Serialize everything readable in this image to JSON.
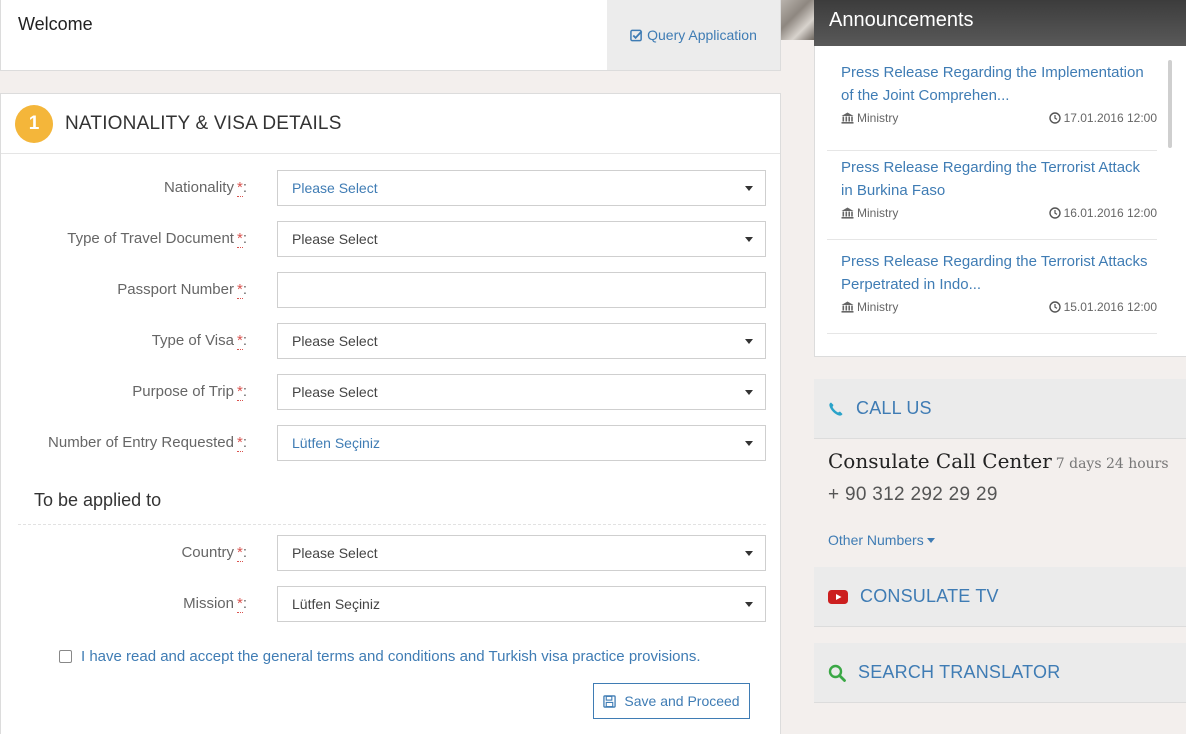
{
  "header": {
    "welcome": "Welcome",
    "query_application": "Query Application"
  },
  "form": {
    "step_number": "1",
    "section_title": "NATIONALITY & VISA DETAILS",
    "required_marker": "*",
    "colon": ":",
    "fields": [
      {
        "label": "Nationality",
        "value": "Please Select",
        "type": "select"
      },
      {
        "label": "Type of Travel Document",
        "value": "Please Select",
        "type": "select"
      },
      {
        "label": "Passport Number",
        "value": "",
        "type": "text"
      },
      {
        "label": "Type of Visa",
        "value": "Please Select",
        "type": "select"
      },
      {
        "label": "Purpose of Trip",
        "value": "Please Select",
        "type": "select"
      },
      {
        "label": "Number of Entry Requested",
        "value": "Lütfen Seçiniz",
        "type": "select"
      }
    ],
    "applied_to_heading": "To be applied to",
    "applied_fields": [
      {
        "label": "Country",
        "value": "Please Select",
        "type": "select"
      },
      {
        "label": "Mission",
        "value": "Lütfen Seçiniz",
        "type": "select"
      }
    ],
    "terms_text": "I have read and accept the general terms and conditions and Turkish visa practice provisions.",
    "save_button": "Save and Proceed"
  },
  "announcements": {
    "title": "Announcements",
    "items": [
      {
        "title": "Press Release Regarding the Implementation of the Joint Comprehen...",
        "source": "Ministry",
        "date": "17.01.2016 12:00"
      },
      {
        "title": "Press Release Regarding the Terrorist Attack in Burkina Faso",
        "source": "Ministry",
        "date": "16.01.2016 12:00"
      },
      {
        "title": "Press Release Regarding the Terrorist Attacks Perpetrated in Indo...",
        "source": "Ministry",
        "date": "15.01.2016 12:00"
      }
    ]
  },
  "sidebar": {
    "call_us": "CALL US",
    "call_center_name": "Consulate Call Center",
    "call_center_hours": "7 days 24 hours",
    "phone": "+ 90 312 292 29 29",
    "other_numbers": "Other Numbers",
    "consulate_tv": "CONSULATE TV",
    "search_translator": "SEARCH TRANSLATOR"
  },
  "colors": {
    "accent_blue": "#3f7cb4",
    "step_badge": "#f4b63a",
    "required_red": "#d9534f",
    "phone_icon": "#2aa3c9",
    "youtube_red": "#cc1f1f",
    "search_green": "#3aa845"
  }
}
